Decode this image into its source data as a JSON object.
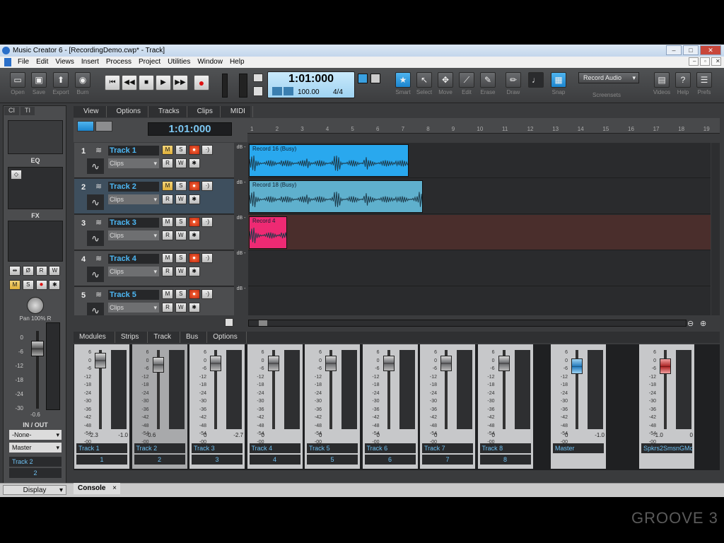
{
  "window": {
    "title": "Music Creator 6 - [RecordingDemo.cwp* - Track]",
    "controls": [
      "–",
      "□",
      "✕"
    ]
  },
  "menubar": {
    "items": [
      "File",
      "Edit",
      "Views",
      "Insert",
      "Process",
      "Project",
      "Utilities",
      "Window",
      "Help"
    ],
    "mdi_controls": [
      "–",
      "▫",
      "✕"
    ]
  },
  "toolbar": {
    "file_buttons": [
      {
        "label": "Open",
        "icon": "folder-icon"
      },
      {
        "label": "Save",
        "icon": "save-icon"
      },
      {
        "label": "Export",
        "icon": "export-icon"
      },
      {
        "label": "Burn",
        "icon": "burn-icon"
      }
    ],
    "transport": [
      "⏮",
      "◀◀",
      "■",
      "▶",
      "▶▶",
      "●"
    ],
    "time": "1:01:000",
    "tempo": "100.00",
    "meter": "4/4",
    "tools": [
      {
        "label": "Smart",
        "icon": "star-icon"
      },
      {
        "label": "Select",
        "icon": "arrow-icon"
      },
      {
        "label": "Move",
        "icon": "move-icon"
      },
      {
        "label": "Edit",
        "icon": "edit-icon"
      },
      {
        "label": "Erase",
        "icon": "erase-icon"
      },
      {
        "label": "Draw",
        "icon": "pencil-icon"
      },
      {
        "label": "",
        "icon": "note-icon"
      },
      {
        "label": "Snap",
        "icon": "snap-icon"
      }
    ],
    "record_mode": "Record Audio",
    "screensets_label": "Screensets",
    "right_buttons": [
      {
        "label": "Videos",
        "icon": "film-icon"
      },
      {
        "label": "Help",
        "icon": "?"
      },
      {
        "label": "Prefs",
        "icon": "prefs-icon"
      }
    ]
  },
  "inspector": {
    "tabs": [
      "CI",
      "TI"
    ],
    "eq_label": "EQ",
    "fx_label": "FX",
    "pan_label": "Pan 100% R",
    "scale": [
      "0",
      "-6",
      "-12",
      "-18",
      "-24",
      "-30"
    ],
    "fader_value": "-0.6",
    "io_label": "IN / OUT",
    "input": "-None-",
    "output": "Master",
    "track_name": "Track 2",
    "track_number": "2",
    "display_label": "Display"
  },
  "trackview": {
    "menu": [
      "View",
      "Options",
      "Tracks",
      "Clips",
      "MIDI"
    ],
    "time": "1:01:000",
    "ruler": [
      "1",
      "2",
      "3",
      "4",
      "5",
      "6",
      "7",
      "8",
      "9",
      "10",
      "11",
      "12",
      "13",
      "14",
      "15",
      "16",
      "17",
      "18",
      "19"
    ],
    "tracks": [
      {
        "num": "1",
        "name": "Track 1",
        "clips": "Clips",
        "mute_on": true,
        "clip": {
          "label": "Record 16 (Busy)",
          "color": "#29a8ee"
        }
      },
      {
        "num": "2",
        "name": "Track 2",
        "clips": "Clips",
        "mute_on": true,
        "clip": {
          "label": "Record 18 (Busy)",
          "color": "#5fb0cd"
        }
      },
      {
        "num": "3",
        "name": "Track 3",
        "clips": "Clips",
        "mute_on": false,
        "clip": {
          "label": "Record 4",
          "color": "#ee2a73"
        }
      },
      {
        "num": "4",
        "name": "Track 4",
        "clips": "Clips",
        "mute_on": false
      },
      {
        "num": "5",
        "name": "Track 5",
        "clips": "Clips",
        "mute_on": false
      }
    ],
    "db_label": "dB -",
    "button_labels": {
      "m": "M",
      "s": "S",
      "r": "R",
      "w": "W",
      "fx": "✱"
    }
  },
  "console": {
    "menu": [
      "Modules",
      "Strips",
      "Track",
      "Bus",
      "Options"
    ],
    "scale": [
      "6",
      "0",
      "-6",
      "-12",
      "-18",
      "-24",
      "-30",
      "-36",
      "-42",
      "-48",
      "-54",
      "-00"
    ],
    "strips": [
      {
        "name": "Track 1",
        "num": "1",
        "val_left": "-2.3",
        "val_right": "-1.0"
      },
      {
        "name": "Track 2",
        "num": "2",
        "val_left": "-0.6",
        "val_right": ""
      },
      {
        "name": "Track 3",
        "num": "3",
        "val_left": "0",
        "val_right": "-2.7"
      },
      {
        "name": "Track 4",
        "num": "4",
        "val_left": "0",
        "val_right": ""
      },
      {
        "name": "Track 5",
        "num": "5",
        "val_left": "0",
        "val_right": ""
      },
      {
        "name": "Track 6",
        "num": "6",
        "val_left": "0",
        "val_right": ""
      },
      {
        "name": "Track 7",
        "num": "7",
        "val_left": "0",
        "val_right": ""
      },
      {
        "name": "Track 8",
        "num": "8",
        "val_left": "0",
        "val_right": ""
      }
    ],
    "master": {
      "name": "Master",
      "val_left": "0",
      "val_right": "-1.0"
    },
    "output": {
      "name": "Spkrs2SmsnGMc",
      "val_left": "-1.0",
      "val_right": "0"
    },
    "tab": "Console",
    "tab_close": "×"
  },
  "watermark": "GROOVE 3"
}
